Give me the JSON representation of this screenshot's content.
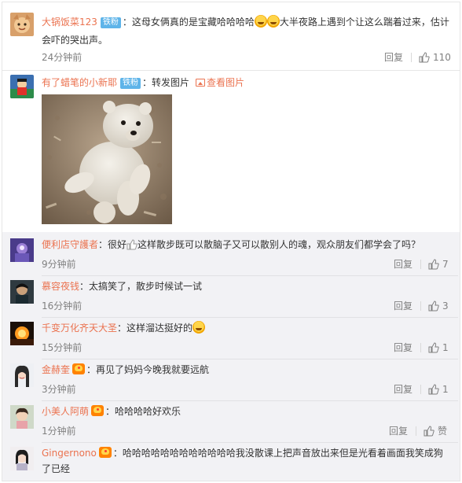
{
  "comments": [
    {
      "user": "大锅饭菜123",
      "badge": "铁粉",
      "text_a": "：这母女俩真的是宝藏哈哈哈哈",
      "text_b": "大半夜路上遇到个让这么踹着过来，估计",
      "text_c": "会吓的哭出声。",
      "time": "24分钟前",
      "reply": "回复",
      "likes": "110"
    },
    {
      "user": "有了蜡笔的小新耶",
      "badge": "铁粉",
      "text": "：转发图片",
      "view_pic": "查看图片"
    }
  ],
  "replies": [
    {
      "user": "便利店守護者",
      "text": "：很好",
      "text2": "这样散步既可以散脑子又可以散别人的魂，观众朋友们都学会了吗？",
      "time": "9分钟前",
      "reply": "回复",
      "likes": "7"
    },
    {
      "user": "慕容夜钱",
      "text": "：太搞笑了，散步时候试一试",
      "time": "16分钟前",
      "reply": "回复",
      "likes": "3"
    },
    {
      "user": "千变万化齐天大圣",
      "text": "：这样溜达挺好的",
      "time": "15分钟前",
      "reply": "回复",
      "likes": "1"
    },
    {
      "user": "金赫奎",
      "text": "：再见了妈妈今晚我就要远航",
      "time": "3分钟前",
      "reply": "回复",
      "likes": "1"
    },
    {
      "user": "小美人阿萌",
      "text": "：哈哈哈哈好欢乐",
      "time": "1分钟前",
      "reply": "回复",
      "likes": "赞"
    },
    {
      "user": "Gingernono",
      "text": "：哈哈哈哈哈哈哈哈哈哈哈哈我没散课上把声音放出来但是光看着画面我笑成狗",
      "text2": "了已经"
    }
  ],
  "colors": {
    "username": "#eb7350",
    "meta": "#808080",
    "badge": "#5eb4e9",
    "grey_bg": "#f2f2f5"
  }
}
